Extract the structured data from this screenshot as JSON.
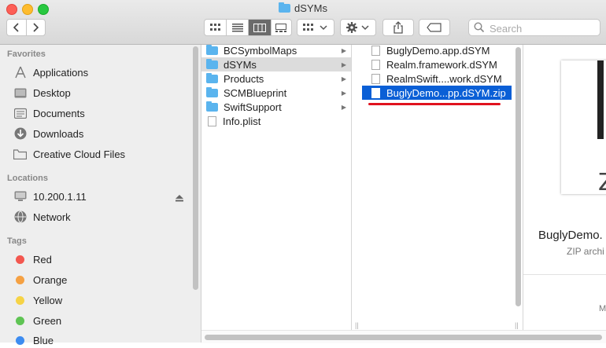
{
  "window": {
    "title": "dSYMs"
  },
  "toolbar": {
    "search_placeholder": "Search"
  },
  "sidebar": {
    "favorites_header": "Favorites",
    "favorites": [
      {
        "label": "Applications"
      },
      {
        "label": "Desktop"
      },
      {
        "label": "Documents"
      },
      {
        "label": "Downloads"
      },
      {
        "label": "Creative Cloud Files"
      }
    ],
    "locations_header": "Locations",
    "locations": [
      {
        "label": "10.200.1.11"
      },
      {
        "label": "Network"
      }
    ],
    "tags_header": "Tags",
    "tags": [
      {
        "label": "Red",
        "color": "#f3574f"
      },
      {
        "label": "Orange",
        "color": "#f5a143"
      },
      {
        "label": "Yellow",
        "color": "#f6d346"
      },
      {
        "label": "Green",
        "color": "#5fc454"
      },
      {
        "label": "Blue",
        "color": "#3d8cf0"
      }
    ]
  },
  "column1": {
    "items": [
      {
        "label": "BCSymbolMaps"
      },
      {
        "label": "dSYMs"
      },
      {
        "label": "Products"
      },
      {
        "label": "SCMBlueprint"
      },
      {
        "label": "SwiftSupport"
      },
      {
        "label": "Info.plist"
      }
    ]
  },
  "column2": {
    "items": [
      {
        "label": "BuglyDemo.app.dSYM"
      },
      {
        "label": "Realm.framework.dSYM"
      },
      {
        "label": "RealmSwift....work.dSYM"
      },
      {
        "label": "BuglyDemo...pp.dSYM.zip"
      }
    ]
  },
  "preview": {
    "icon_text": "Z",
    "name": "BuglyDemo.",
    "kind": "ZIP archi",
    "more": "M"
  },
  "colors": {
    "selection": "#0a5fd6",
    "annotation": "#e0121e"
  }
}
